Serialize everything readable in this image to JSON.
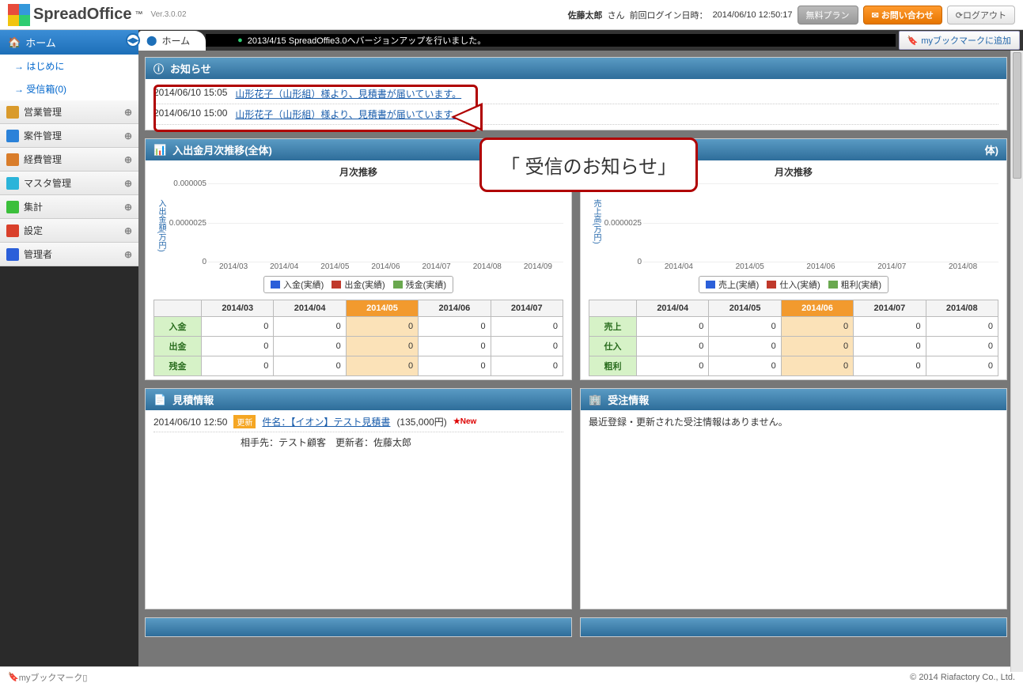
{
  "app": {
    "name": "SpreadOffice",
    "tm": "™",
    "version": "Ver.3.0.02"
  },
  "header": {
    "user": "佐藤太郎",
    "user_suffix": "さん",
    "last_login_label": "前回ログイン日時：",
    "last_login_value": "2014/06/10 12:50:17",
    "plan_btn": "無料プラン",
    "contact_btn": "✉ お問い合わせ",
    "logout_btn": "⟳ログアウト"
  },
  "sidebar": {
    "home": "ホーム",
    "subs": [
      "はじめに",
      "受信箱(0)"
    ],
    "items": [
      {
        "label": "営業管理",
        "icon_color": "#d99a2b"
      },
      {
        "label": "案件管理",
        "icon_color": "#2b82d9"
      },
      {
        "label": "経費管理",
        "icon_color": "#d97d2b"
      },
      {
        "label": "マスタ管理",
        "icon_color": "#2bb4d9"
      },
      {
        "label": "集計",
        "icon_color": "#3bbf3b"
      },
      {
        "label": "設定",
        "icon_color": "#d9402b"
      },
      {
        "label": "管理者",
        "icon_color": "#2b5fd9"
      }
    ]
  },
  "tabbar": {
    "tab_label": "ホーム",
    "banner": "2013/4/15 SpreadOffie3.0へバージョンアップを行いました。",
    "bookmark_btn": "myブックマークに追加"
  },
  "panels": {
    "notice": {
      "title": "お知らせ",
      "rows": [
        {
          "ts": "2014/06/10 15:05",
          "text": "山形花子（山形組）様より、見積書が届いています。"
        },
        {
          "ts": "2014/06/10 15:00",
          "text": "山形花子（山形組）様より、見積書が届いています。"
        }
      ]
    },
    "callout_text": "「 受信のお知らせ」",
    "left_chart_title": "入出金月次推移(全体)",
    "right_chart_title_suffix": "体)",
    "estimate": {
      "title": "見積情報",
      "ts": "2014/06/10 12:50",
      "badge": "更新",
      "link": "件名：【イオン】テスト見積書",
      "amount": "(135,000円)",
      "new": "★New",
      "line2": "相手先：テスト顧客　更新者：佐藤太郎"
    },
    "order": {
      "title": "受注情報",
      "empty": "最近登録・更新された受注情報はありません。"
    }
  },
  "chart_data": [
    {
      "type": "bar",
      "title": "月次推移",
      "ylabel": "入出金額(万円)",
      "ylim": [
        0,
        5e-06
      ],
      "yticks": [
        0,
        2.5e-06,
        5e-06
      ],
      "categories": [
        "2014/03",
        "2014/04",
        "2014/05",
        "2014/06",
        "2014/07",
        "2014/08",
        "2014/09"
      ],
      "series": [
        {
          "name": "入金(実績)",
          "color": "#2b5fd9",
          "values": [
            0,
            0,
            0,
            0,
            0,
            0,
            0
          ]
        },
        {
          "name": "出金(実績)",
          "color": "#c0392b",
          "values": [
            0,
            0,
            0,
            0,
            0,
            0,
            0
          ]
        },
        {
          "name": "残金(実績)",
          "color": "#6aa84f",
          "values": [
            0,
            0,
            0,
            0,
            0,
            0,
            0
          ]
        }
      ],
      "table": {
        "cols": [
          "2014/03",
          "2014/04",
          "2014/05",
          "2014/06",
          "2014/07"
        ],
        "highlight_col": 2,
        "rows": [
          {
            "head": "入金",
            "vals": [
              0,
              0,
              0,
              0,
              0
            ]
          },
          {
            "head": "出金",
            "vals": [
              0,
              0,
              0,
              0,
              0
            ]
          },
          {
            "head": "残金",
            "vals": [
              0,
              0,
              0,
              0,
              0
            ]
          }
        ]
      }
    },
    {
      "type": "bar",
      "title": "月次推移",
      "ylabel": "売上高(万円)",
      "ylim": [
        0,
        5e-06
      ],
      "yticks": [
        0,
        2.5e-06,
        5e-06
      ],
      "categories": [
        "2014/04",
        "2014/05",
        "2014/06",
        "2014/07",
        "2014/08"
      ],
      "series": [
        {
          "name": "売上(実績)",
          "color": "#2b5fd9",
          "values": [
            0,
            0,
            0,
            0,
            0
          ]
        },
        {
          "name": "仕入(実績)",
          "color": "#c0392b",
          "values": [
            0,
            0,
            0,
            0,
            0
          ]
        },
        {
          "name": "粗利(実績)",
          "color": "#6aa84f",
          "values": [
            0,
            0,
            0,
            0,
            0
          ]
        }
      ],
      "table": {
        "cols": [
          "2014/04",
          "2014/05",
          "2014/06",
          "2014/07",
          "2014/08"
        ],
        "highlight_col": 2,
        "rows": [
          {
            "head": "売上",
            "vals": [
              0,
              0,
              0,
              0,
              0
            ]
          },
          {
            "head": "仕入",
            "vals": [
              0,
              0,
              0,
              0,
              0
            ]
          },
          {
            "head": "粗利",
            "vals": [
              0,
              0,
              0,
              0,
              0
            ]
          }
        ]
      }
    }
  ],
  "footer": {
    "bookmark": "myブックマーク▯",
    "copyright": "© 2014 Riafactory Co., Ltd."
  }
}
